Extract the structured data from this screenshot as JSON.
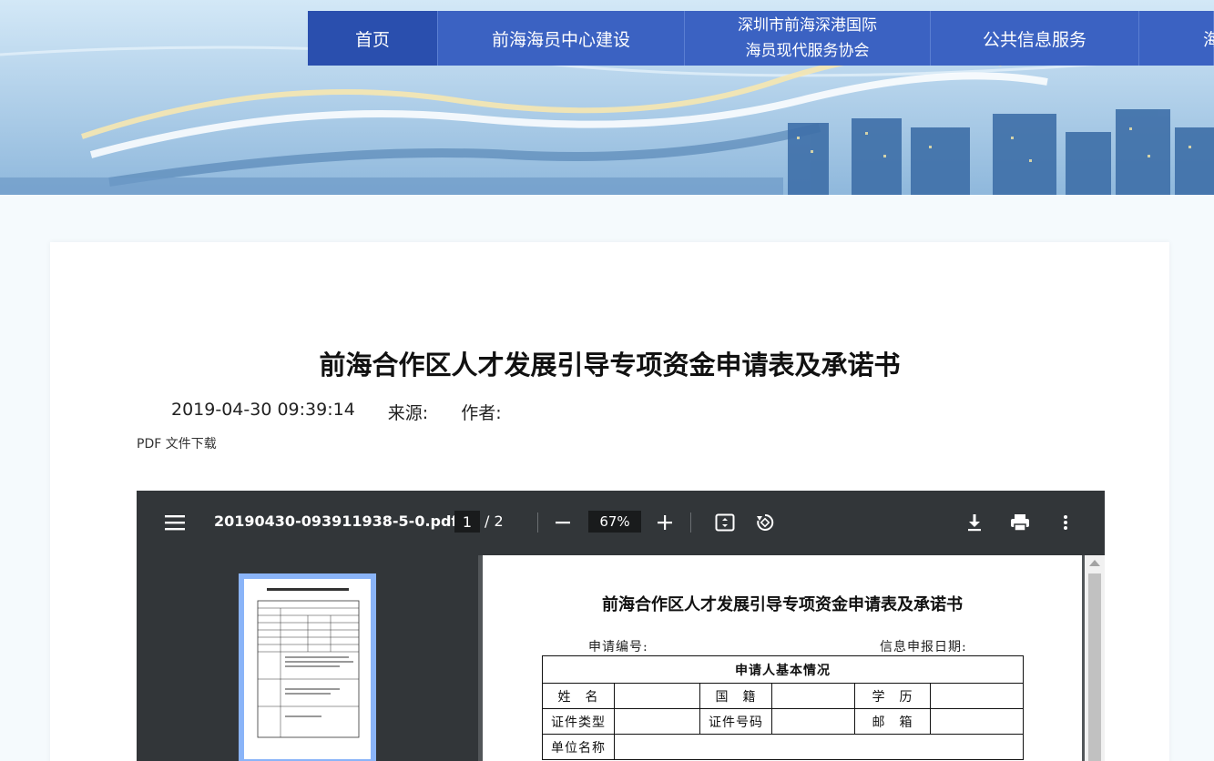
{
  "nav": {
    "items": [
      {
        "label": "首页"
      },
      {
        "label": "前海海员中心建设"
      },
      {
        "label_line1": "深圳市前海深港国际",
        "label_line2": "海员现代服务协会"
      },
      {
        "label": "公共信息服务"
      },
      {
        "label": "海"
      }
    ]
  },
  "article": {
    "title": "前海合作区人才发展引导专项资金申请表及承诺书",
    "date": "2019-04-30 09:39:14",
    "source_label": "来源:",
    "author_label": "作者:",
    "pdf_link": "PDF 文件下载"
  },
  "pdf_viewer": {
    "filename": "20190430-093911938-5-0.pdf",
    "current_page": "1",
    "page_total": "/  2",
    "zoom": "67%",
    "icons": [
      "menu-icon",
      "zoom-out-icon",
      "zoom-in-icon",
      "fit-page-icon",
      "rotate-icon",
      "download-icon",
      "print-icon",
      "more-icon"
    ]
  },
  "document": {
    "title": "前海合作区人才发展引导专项资金申请表及承诺书",
    "application_no_label": "申请编号:",
    "report_date_label": "信息申报日期:",
    "section_header": "申请人基本情况",
    "rows": [
      [
        "姓　名",
        "",
        "国　籍",
        "",
        "学　历",
        ""
      ],
      [
        "证件类型",
        "",
        "证件号码",
        "",
        "邮　箱",
        ""
      ],
      [
        "单位名称",
        ""
      ]
    ]
  }
}
